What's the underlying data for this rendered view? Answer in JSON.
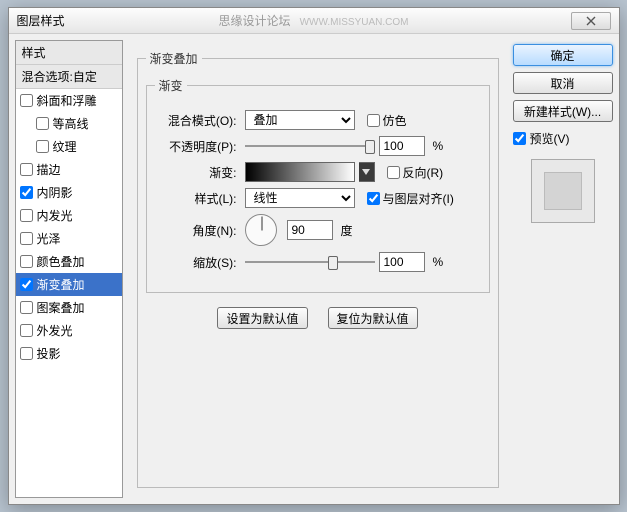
{
  "window": {
    "title": "图层样式",
    "watermark": "思缘设计论坛",
    "watermark_url": "WWW.MISSYUAN.COM"
  },
  "sidebar": {
    "header": "样式",
    "blending": "混合选项:自定",
    "items": [
      {
        "label": "斜面和浮雕",
        "checked": false,
        "indent": false
      },
      {
        "label": "等高线",
        "checked": false,
        "indent": true
      },
      {
        "label": "纹理",
        "checked": false,
        "indent": true
      },
      {
        "label": "描边",
        "checked": false,
        "indent": false
      },
      {
        "label": "内阴影",
        "checked": true,
        "indent": false
      },
      {
        "label": "内发光",
        "checked": false,
        "indent": false
      },
      {
        "label": "光泽",
        "checked": false,
        "indent": false
      },
      {
        "label": "颜色叠加",
        "checked": false,
        "indent": false
      },
      {
        "label": "渐变叠加",
        "checked": true,
        "indent": false,
        "selected": true
      },
      {
        "label": "图案叠加",
        "checked": false,
        "indent": false
      },
      {
        "label": "外发光",
        "checked": false,
        "indent": false
      },
      {
        "label": "投影",
        "checked": false,
        "indent": false
      }
    ]
  },
  "panel": {
    "title": "渐变叠加",
    "subtitle": "渐变",
    "blend_label": "混合模式(O):",
    "blend_value": "叠加",
    "dither_label": "仿色",
    "opacity_label": "不透明度(P):",
    "opacity_value": "100",
    "gradient_label": "渐变:",
    "reverse_label": "反向(R)",
    "style_label": "样式(L):",
    "style_value": "线性",
    "align_label": "与图层对齐(I)",
    "angle_label": "角度(N):",
    "angle_value": "90",
    "angle_unit": "度",
    "scale_label": "缩放(S):",
    "scale_value": "100",
    "percent": "%",
    "make_default": "设置为默认值",
    "reset_default": "复位为默认值"
  },
  "buttons": {
    "ok": "确定",
    "cancel": "取消",
    "new_style": "新建样式(W)...",
    "preview": "预览(V)"
  }
}
